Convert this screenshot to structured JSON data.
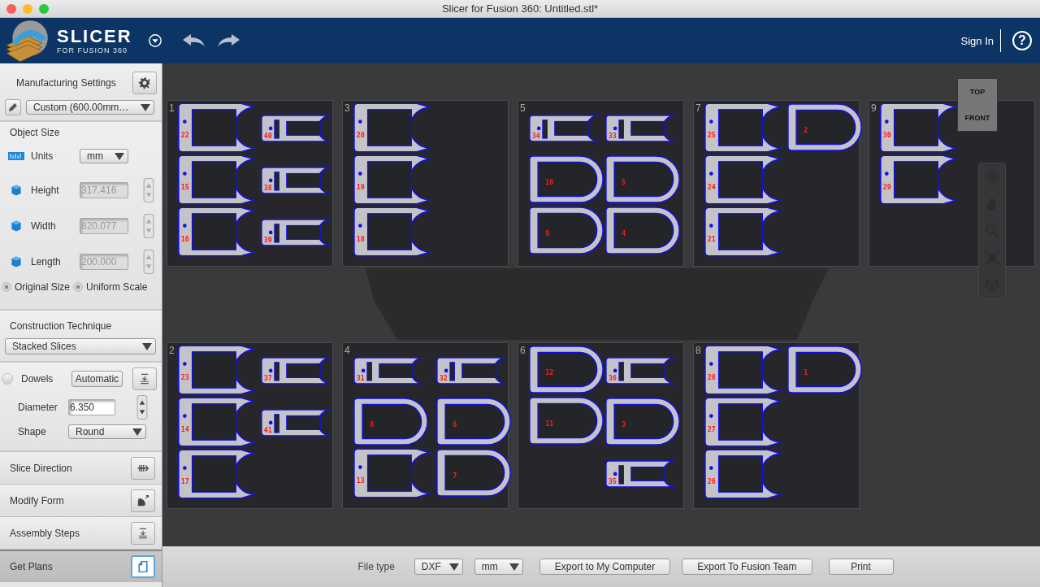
{
  "window": {
    "title": "Slicer for Fusion 360: Untitled.stl*"
  },
  "header": {
    "logo_title": "SLICER",
    "logo_subtitle": "FOR FUSION 360",
    "sign_in": "Sign In",
    "help": "?"
  },
  "sidebar": {
    "manufacturing": {
      "title": "Manufacturing Settings",
      "preset": "Custom (600.00mm…"
    },
    "object_size": {
      "title": "Object Size",
      "units_label": "Units",
      "units_value": "mm",
      "fields": [
        {
          "label": "Height",
          "value": "317.416",
          "disabled": true
        },
        {
          "label": "Width",
          "value": "820.077",
          "disabled": true
        },
        {
          "label": "Length",
          "value": "200.000",
          "disabled": true
        }
      ],
      "radios": [
        {
          "label": "Original Size",
          "selected": false
        },
        {
          "label": "Uniform Scale",
          "selected": false
        }
      ]
    },
    "construction": {
      "title": "Construction Technique",
      "value": "Stacked Slices"
    },
    "dowels": {
      "label": "Dowels",
      "checked": false,
      "mode": "Automatic",
      "diameter_label": "Diameter",
      "diameter": "6.350",
      "shape_label": "Shape",
      "shape": "Round"
    },
    "steps": [
      {
        "label": "Slice Direction",
        "kind": "direction",
        "selected": false
      },
      {
        "label": "Modify Form",
        "kind": "form",
        "selected": false
      },
      {
        "label": "Assembly Steps",
        "kind": "assembly",
        "selected": false
      },
      {
        "label": "Get Plans",
        "kind": "plans",
        "selected": true
      }
    ]
  },
  "sheets": [
    {
      "number": "1",
      "columns": [
        [
          {
            "kind": "large",
            "label": "22"
          },
          {
            "kind": "large",
            "label": "15"
          },
          {
            "kind": "large",
            "label": "16"
          }
        ],
        [
          {
            "kind": "small",
            "label": "40"
          },
          {
            "kind": "small",
            "label": "38"
          },
          {
            "kind": "small",
            "label": "39"
          }
        ]
      ]
    },
    {
      "number": "3",
      "columns": [
        [
          {
            "kind": "large",
            "label": "20"
          },
          {
            "kind": "large",
            "label": "19"
          },
          {
            "kind": "large",
            "label": "18"
          }
        ]
      ]
    },
    {
      "number": "5",
      "columns": [
        [
          {
            "kind": "small",
            "label": "34"
          },
          {
            "kind": "round",
            "label": "10"
          },
          {
            "kind": "round",
            "label": "9"
          }
        ],
        [
          {
            "kind": "small",
            "label": "33"
          },
          {
            "kind": "round",
            "label": "5"
          },
          {
            "kind": "round",
            "label": "4"
          }
        ]
      ]
    },
    {
      "number": "7",
      "columns": [
        [
          {
            "kind": "large",
            "label": "25"
          },
          {
            "kind": "large",
            "label": "24"
          },
          {
            "kind": "large",
            "label": "21"
          }
        ],
        [
          {
            "kind": "round",
            "label": "2"
          }
        ]
      ]
    },
    {
      "number": "9",
      "columns": [
        [
          {
            "kind": "large",
            "label": "30"
          },
          {
            "kind": "large",
            "label": "29"
          }
        ]
      ]
    },
    {
      "number": "2",
      "columns": [
        [
          {
            "kind": "large",
            "label": "23"
          },
          {
            "kind": "large",
            "label": "14"
          },
          {
            "kind": "large",
            "label": "17"
          }
        ],
        [
          {
            "kind": "small",
            "label": "37"
          },
          {
            "kind": "small",
            "label": "41"
          }
        ]
      ]
    },
    {
      "number": "4",
      "columns": [
        [
          {
            "kind": "small",
            "label": "31"
          },
          {
            "kind": "round",
            "label": "8"
          },
          {
            "kind": "large",
            "label": "13"
          }
        ],
        [
          {
            "kind": "small",
            "label": "32"
          },
          {
            "kind": "round",
            "label": "6"
          },
          {
            "kind": "round",
            "label": "7"
          }
        ]
      ]
    },
    {
      "number": "6",
      "columns": [
        [
          {
            "kind": "round",
            "label": "12"
          },
          {
            "kind": "round",
            "label": "11"
          }
        ],
        [
          {
            "kind": "small",
            "label": "36"
          },
          {
            "kind": "round",
            "label": "3"
          },
          {
            "kind": "small",
            "label": "35"
          }
        ]
      ]
    },
    {
      "number": "8",
      "columns": [
        [
          {
            "kind": "large",
            "label": "28"
          },
          {
            "kind": "large",
            "label": "27"
          },
          {
            "kind": "large",
            "label": "26"
          }
        ],
        [
          {
            "kind": "round",
            "label": "1"
          }
        ]
      ]
    }
  ],
  "view_cube": {
    "top": "TOP",
    "front": "FRONT"
  },
  "export_bar": {
    "file_type_label": "File type",
    "file_type": "DXF",
    "units": "mm",
    "buttons": [
      "Export to My Computer",
      "Export To Fusion Team",
      "Print"
    ]
  }
}
